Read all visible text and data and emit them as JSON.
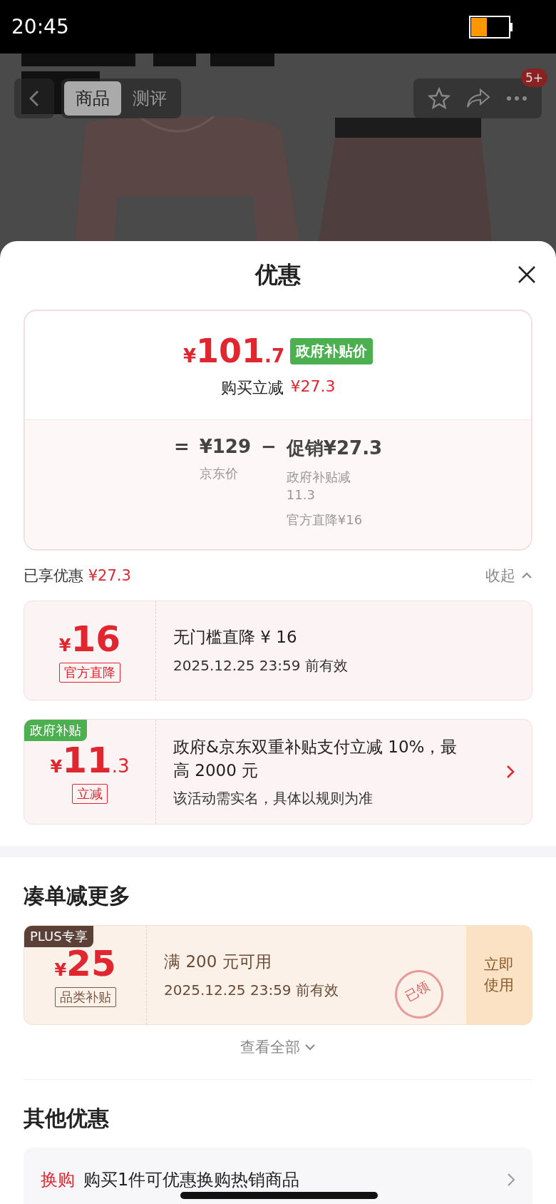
{
  "status_bar": {
    "time": "20:45"
  },
  "nav": {
    "tabs": [
      {
        "label": "商品",
        "selected": true
      },
      {
        "label": "测评",
        "selected": false
      }
    ],
    "badge": "5+"
  },
  "sheet": {
    "title": "优惠",
    "price_card": {
      "currency": "¥",
      "price_int": "101",
      "price_dec": ".7",
      "tag": "政府补贴价",
      "instant_label": "购买立减",
      "instant_amount": "¥27.3",
      "equals": "=",
      "jd_price": "¥129",
      "minus": "−",
      "promo": "促销¥27.3",
      "jd_label": "京东价",
      "details": [
        "政府补贴减11.3",
        "官方直降¥16"
      ]
    },
    "enjoyed": {
      "label": "已享优惠",
      "amount": "¥27.3",
      "toggle": "收起"
    },
    "coupons": [
      {
        "kind": "discount",
        "currency": "¥",
        "amount": "16",
        "tag": "官方直降",
        "title": "无门槛直降 ¥ 16",
        "subtitle": "2025.12.25 23:59 前有效"
      },
      {
        "kind": "discount",
        "ribbon": "政府补贴",
        "currency": "¥",
        "amount": "11",
        "decimal": ".3",
        "tag": "立减",
        "title": "政府&京东双重补贴支付立减 10%，最高 2000 元",
        "subtitle": "该活动需实名，具体以规则为准",
        "arrow": true
      }
    ],
    "more": {
      "title": "凑单减更多",
      "coupons": [
        {
          "kind": "plus",
          "ribbon": "PLUS专享",
          "currency": "¥",
          "amount": "25",
          "tag": "品类补贴",
          "title": "满 200 元可用",
          "subtitle": "2025.12.25 23:59 前有效",
          "action": "立即使用",
          "stamp": "已领"
        }
      ],
      "see_all": "查看全部"
    },
    "other": {
      "title": "其他优惠",
      "rows": [
        {
          "tag": "换购",
          "text": "购买1件可优惠换购热销商品"
        }
      ]
    }
  }
}
